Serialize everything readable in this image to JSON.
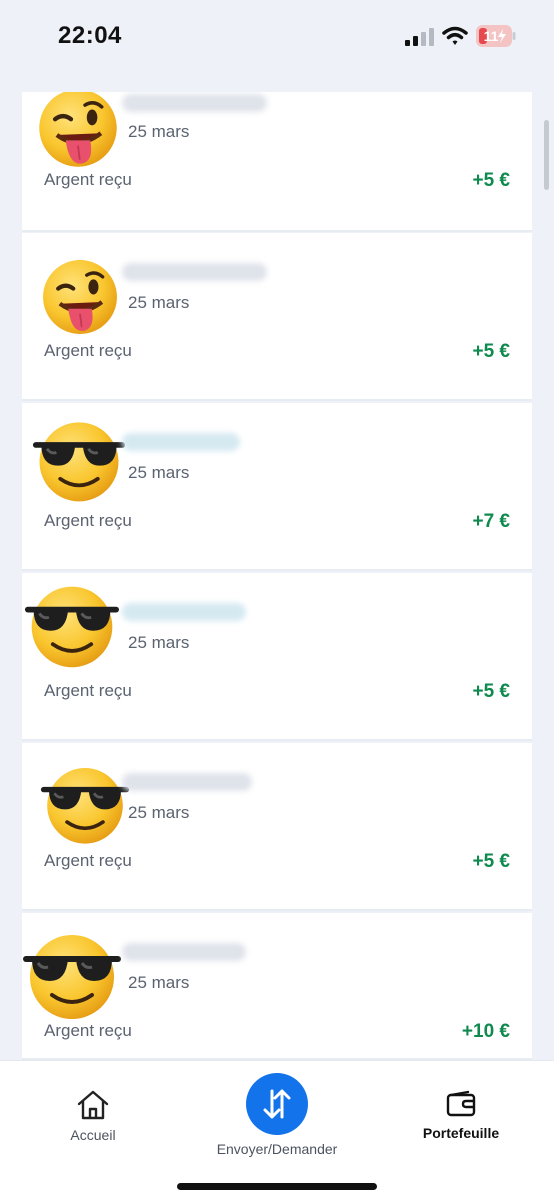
{
  "status_bar": {
    "time": "22:04",
    "battery": "11",
    "battery_color": "#e5484d"
  },
  "transactions": [
    {
      "date": "25 mars",
      "type": "Argent reçu",
      "amount": "+5 €",
      "avatar": "wink-tongue-emoji-icon"
    },
    {
      "date": "25 mars",
      "type": "Argent reçu",
      "amount": "+5 €",
      "avatar": "wink-tongue-emoji-icon"
    },
    {
      "date": "25 mars",
      "type": "Argent reçu",
      "amount": "+7 €",
      "avatar": "sunglasses-emoji-icon"
    },
    {
      "date": "25 mars",
      "type": "Argent reçu",
      "amount": "+5 €",
      "avatar": "sunglasses-emoji-icon"
    },
    {
      "date": "25 mars",
      "type": "Argent reçu",
      "amount": "+5 €",
      "avatar": "sunglasses-emoji-icon"
    },
    {
      "date": "25 mars",
      "type": "Argent reçu",
      "amount": "+10 €",
      "avatar": "sunglasses-emoji-icon"
    }
  ],
  "bottom_nav": {
    "home_label": "Accueil",
    "send_label": "Envoyer/Demander",
    "wallet_label": "Portefeuille",
    "active_tab": "wallet",
    "accent_color": "#1273ea"
  },
  "colors": {
    "amount_positive": "#0f8a4f",
    "background": "#eef1f7"
  }
}
